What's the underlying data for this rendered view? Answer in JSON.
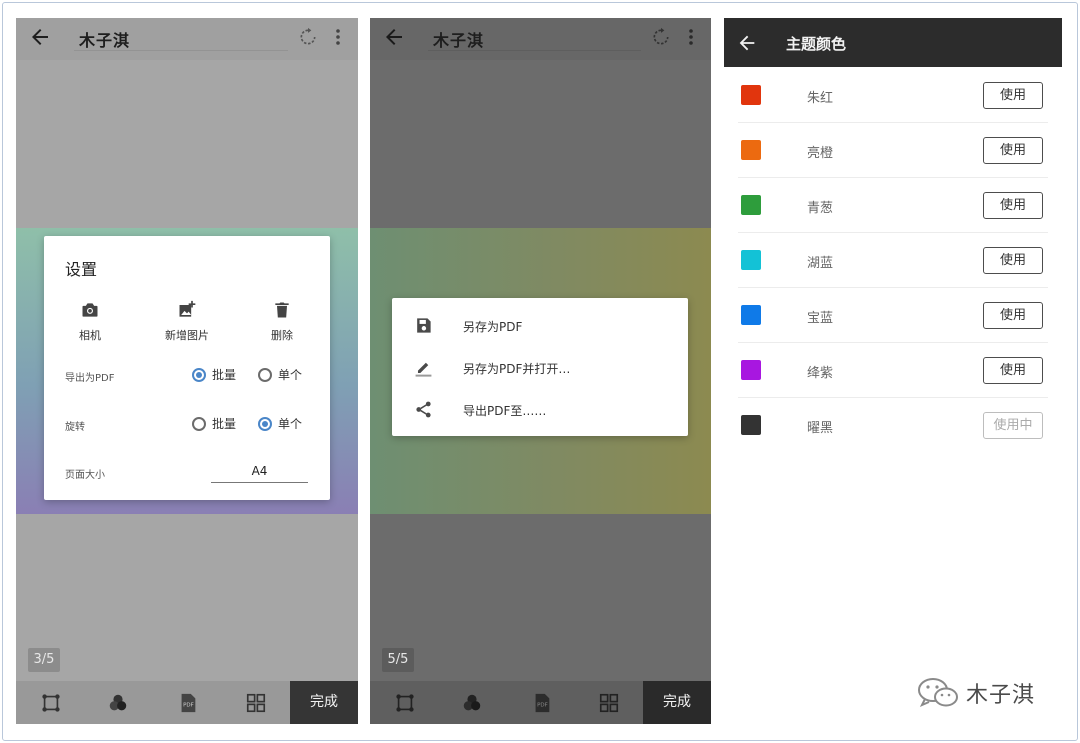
{
  "screen1": {
    "title": "木子淇",
    "page_indicator": "3/5",
    "dialog": {
      "title": "设置",
      "actions": [
        {
          "label": "相机",
          "icon": "camera-icon"
        },
        {
          "label": "新增图片",
          "icon": "add-image-icon"
        },
        {
          "label": "删除",
          "icon": "trash-icon"
        }
      ],
      "export_pdf": {
        "label": "导出为PDF",
        "options": [
          "批量",
          "单个"
        ],
        "selected": "批量"
      },
      "rotate": {
        "label": "旋转",
        "options": [
          "批量",
          "单个"
        ],
        "selected": "单个"
      },
      "page_size": {
        "label": "页面大小",
        "value": "A4"
      }
    },
    "done_label": "完成"
  },
  "screen2": {
    "title": "木子淇",
    "page_indicator": "5/5",
    "menu": [
      {
        "label": "另存为PDF",
        "icon": "save-icon"
      },
      {
        "label": "另存为PDF并打开…",
        "icon": "edit-pencil-icon"
      },
      {
        "label": "导出PDF至……",
        "icon": "share-icon"
      }
    ],
    "done_label": "完成"
  },
  "screen3": {
    "title": "主题颜色",
    "colors": [
      {
        "name": "朱红",
        "color": "#e1350d",
        "button": "使用",
        "active": false
      },
      {
        "name": "亮橙",
        "color": "#ec6a10",
        "button": "使用",
        "active": false
      },
      {
        "name": "青葱",
        "color": "#2e9d3c",
        "button": "使用",
        "active": false
      },
      {
        "name": "湖蓝",
        "color": "#13c2d6",
        "button": "使用",
        "active": false
      },
      {
        "name": "宝蓝",
        "color": "#0f7ae8",
        "button": "使用",
        "active": false
      },
      {
        "name": "绛紫",
        "color": "#a817e0",
        "button": "使用",
        "active": false
      },
      {
        "name": "曜黑",
        "color": "#333333",
        "button": "使用中",
        "active": true
      }
    ]
  },
  "watermark": {
    "text": "木子淇"
  }
}
